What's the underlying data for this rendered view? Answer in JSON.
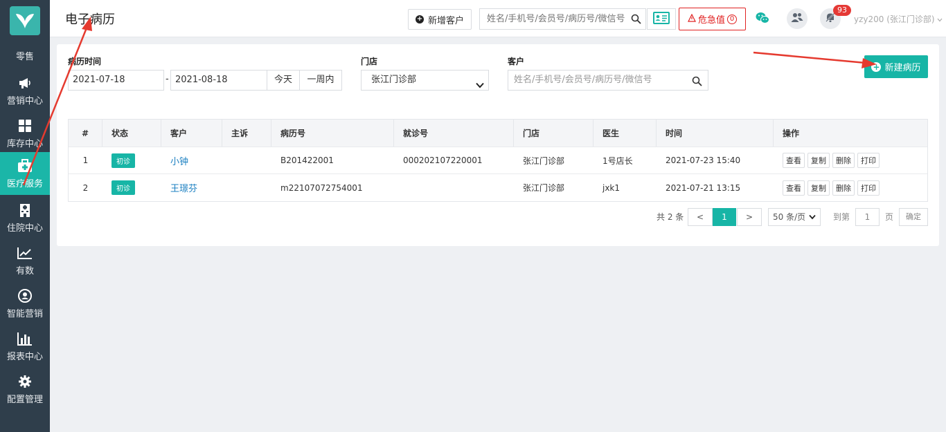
{
  "header": {
    "title": "电子病历",
    "new_customer_label": "新增客户",
    "search_placeholder": "姓名/手机号/会员号/病历号/微信号",
    "critical_label": "危急值",
    "critical_count": "0",
    "notification_badge": "93",
    "user_label": "yzy200 (张江门诊部)"
  },
  "sidebar": {
    "items": [
      {
        "label": "零售",
        "icon": "retail-icon"
      },
      {
        "label": "营销中心",
        "icon": "megaphone-icon"
      },
      {
        "label": "库存中心",
        "icon": "grid-icon"
      },
      {
        "label": "医疗服务",
        "icon": "medical-kit-icon"
      },
      {
        "label": "住院中心",
        "icon": "hospital-icon"
      },
      {
        "label": "有数",
        "icon": "trend-chart-icon"
      },
      {
        "label": "智能营销",
        "icon": "smart-marketing-icon"
      },
      {
        "label": "报表中心",
        "icon": "bar-chart-icon"
      },
      {
        "label": "配置管理",
        "icon": "gear-icon"
      }
    ],
    "active": "医疗服务"
  },
  "filters": {
    "time_label": "病历时间",
    "date_from": "2021-07-18",
    "date_to": "2021-08-18",
    "date_sep": "-",
    "today_label": "今天",
    "week_label": "一周内",
    "store_label": "门店",
    "store_value": "张江门诊部",
    "customer_label": "客户",
    "customer_placeholder": "姓名/手机号/会员号/病历号/微信号"
  },
  "new_record_label": "新建病历",
  "table": {
    "headers": [
      "#",
      "状态",
      "客户",
      "主诉",
      "病历号",
      "就诊号",
      "门店",
      "医生",
      "时间",
      "操作"
    ],
    "rows": [
      {
        "idx": "1",
        "status": "初诊",
        "customer": "小钟",
        "complaint": "",
        "record_no": "B201422001",
        "visit_no": "000202107220001",
        "store": "张江门诊部",
        "doctor": "1号店长",
        "time": "2021-07-23 15:40"
      },
      {
        "idx": "2",
        "status": "初诊",
        "customer": "王璟芬",
        "complaint": "",
        "record_no": "m22107072754001",
        "visit_no": "",
        "store": "张江门诊部",
        "doctor": "jxk1",
        "time": "2021-07-21 13:15"
      }
    ],
    "actions": [
      "查看",
      "复制",
      "删除",
      "打印"
    ]
  },
  "pagination": {
    "total_label": "共 2 条",
    "prev": "<",
    "current": "1",
    "next": ">",
    "page_size": "50 条/页",
    "goto_label": "到第",
    "goto_value": "1",
    "page_unit": "页",
    "confirm_label": "确定"
  },
  "colors": {
    "accent": "#17b5a6",
    "sidebar_bg": "#2f3e4b",
    "danger": "#e02020",
    "link": "#1a7fc1",
    "annotation_arrow": "#e53a2f"
  }
}
